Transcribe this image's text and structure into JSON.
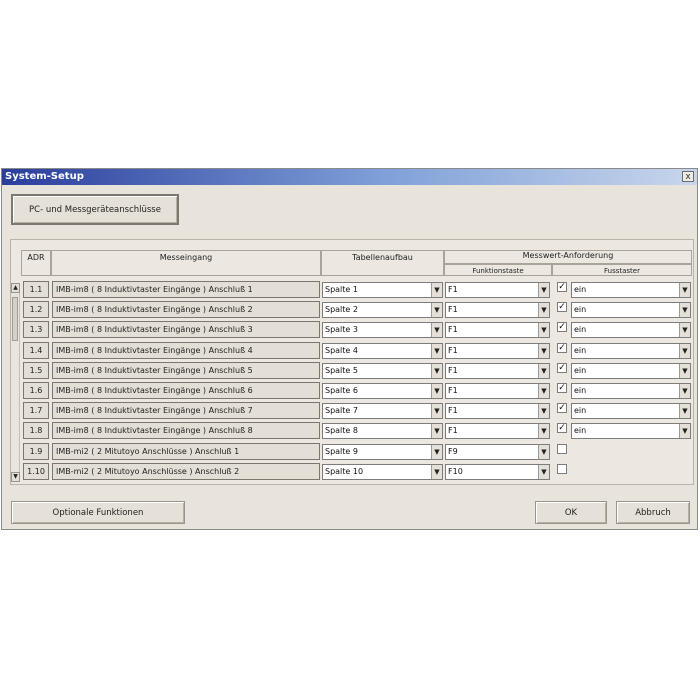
{
  "window": {
    "title": "System-Setup",
    "close_glyph": "x"
  },
  "pc_button": "PC- und Messgeräteanschlüsse",
  "headers": {
    "adr": "ADR",
    "messeingang": "Messeingang",
    "tabellenaufbau": "Tabellenaufbau",
    "anforderung": "Messwert-Anforderung",
    "funktionstaste": "Funktionstaste",
    "fusstaster": "Fusstaster"
  },
  "rows": [
    {
      "adr": "1.1",
      "messeingang": "IMB-im8 ( 8 Induktivtaster Eingänge )  Anschluß 1",
      "spalte": "Spalte 1",
      "taste": "F1",
      "checked": true,
      "fuss": "ein"
    },
    {
      "adr": "1.2",
      "messeingang": "IMB-im8 ( 8 Induktivtaster Eingänge )  Anschluß 2",
      "spalte": "Spalte 2",
      "taste": "F1",
      "checked": true,
      "fuss": "ein"
    },
    {
      "adr": "1.3",
      "messeingang": "IMB-im8 ( 8 Induktivtaster Eingänge )  Anschluß 3",
      "spalte": "Spalte 3",
      "taste": "F1",
      "checked": true,
      "fuss": "ein"
    },
    {
      "adr": "1.4",
      "messeingang": "IMB-im8 ( 8 Induktivtaster Eingänge )  Anschluß 4",
      "spalte": "Spalte 4",
      "taste": "F1",
      "checked": true,
      "fuss": "ein"
    },
    {
      "adr": "1.5",
      "messeingang": "IMB-im8 ( 8 Induktivtaster Eingänge )  Anschluß 5",
      "spalte": "Spalte 5",
      "taste": "F1",
      "checked": true,
      "fuss": "ein"
    },
    {
      "adr": "1.6",
      "messeingang": "IMB-im8 ( 8 Induktivtaster Eingänge )  Anschluß 6",
      "spalte": "Spalte 6",
      "taste": "F1",
      "checked": true,
      "fuss": "ein"
    },
    {
      "adr": "1.7",
      "messeingang": "IMB-im8 ( 8 Induktivtaster Eingänge )  Anschluß 7",
      "spalte": "Spalte 7",
      "taste": "F1",
      "checked": true,
      "fuss": "ein"
    },
    {
      "adr": "1.8",
      "messeingang": "IMB-im8 ( 8 Induktivtaster Eingänge )  Anschluß 8",
      "spalte": "Spalte 8",
      "taste": "F1",
      "checked": true,
      "fuss": "ein"
    },
    {
      "adr": "1.9",
      "messeingang": "IMB-mi2 ( 2 Mitutoyo Anschlüsse )  Anschluß 1",
      "spalte": "Spalte 9",
      "taste": "F9",
      "checked": false,
      "fuss": ""
    },
    {
      "adr": "1.10",
      "messeingang": "IMB-mi2 ( 2 Mitutoyo Anschlüsse )  Anschluß 2",
      "spalte": "Spalte 10",
      "taste": "F10",
      "checked": false,
      "fuss": ""
    }
  ],
  "footer": {
    "optional": "Optionale Funktionen",
    "ok": "OK",
    "cancel": "Abbruch"
  },
  "glyphs": {
    "dropdown": "▼",
    "scroll_up": "▲",
    "scroll_down": "▼",
    "check": "✓"
  },
  "colors": {
    "titlebar_start": "#2a3d9c",
    "titlebar_end": "#c9d6ec",
    "dialog_bg": "#e8e4dc"
  }
}
